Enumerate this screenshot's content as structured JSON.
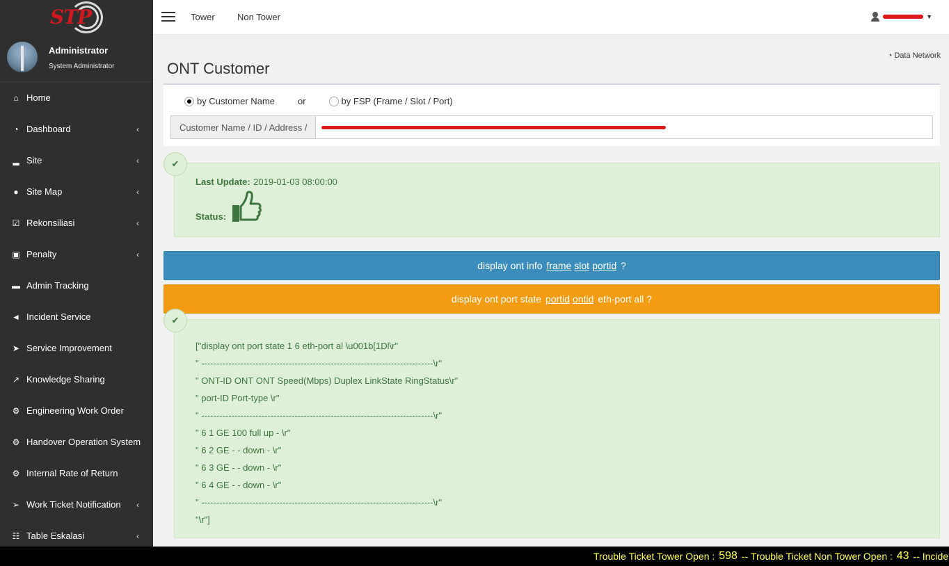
{
  "app": {
    "logo_text": "STP"
  },
  "user_panel": {
    "name": "Administrator",
    "role": "System Administrator"
  },
  "sidebar": {
    "items": [
      {
        "label": "Home",
        "icon": "home-icon",
        "glyph": "⌂",
        "chevron": false
      },
      {
        "label": "Dashboard",
        "icon": "dashboard-icon",
        "glyph": "◔",
        "chevron": true
      },
      {
        "label": "Site",
        "icon": "signal-icon",
        "glyph": "▂",
        "chevron": true
      },
      {
        "label": "Site Map",
        "icon": "globe-icon",
        "glyph": "●",
        "chevron": true
      },
      {
        "label": "Rekonsiliasi",
        "icon": "check-square-icon",
        "glyph": "☑",
        "chevron": true
      },
      {
        "label": "Penalty",
        "icon": "money-icon",
        "glyph": "▣",
        "chevron": true
      },
      {
        "label": "Admin Tracking",
        "icon": "folder-icon",
        "glyph": "▬",
        "chevron": false
      },
      {
        "label": "Incident Service",
        "icon": "bullhorn-icon",
        "glyph": "◄",
        "chevron": false
      },
      {
        "label": "Service Improvement",
        "icon": "rocket-icon",
        "glyph": "➤",
        "chevron": false
      },
      {
        "label": "Knowledge Sharing",
        "icon": "share-icon",
        "glyph": "↗",
        "chevron": false
      },
      {
        "label": "Engineering Work Order",
        "icon": "cogs-icon",
        "glyph": "⚙",
        "chevron": false
      },
      {
        "label": "Handover Operation System",
        "icon": "cogs-icon",
        "glyph": "⚙",
        "chevron": false
      },
      {
        "label": "Internal Rate of Return",
        "icon": "cogs-icon",
        "glyph": "⚙",
        "chevron": false
      },
      {
        "label": "Work Ticket Notification",
        "icon": "location-arrow-icon",
        "glyph": "➢",
        "chevron": true
      },
      {
        "label": "Table Eskalasi",
        "icon": "table-icon",
        "glyph": "☷",
        "chevron": true
      }
    ]
  },
  "topbar": {
    "nav": [
      "Tower",
      "Non Tower"
    ]
  },
  "page": {
    "title": "ONT Customer",
    "breadcrumb": "Data Network"
  },
  "search": {
    "option_customer": "by Customer Name",
    "or_text": "or",
    "option_fsp": "by FSP (Frame / Slot / Port)",
    "addon_label": "Customer Name / ID / Address /"
  },
  "status": {
    "last_update_label": "Last Update:",
    "last_update_value": "2019-01-03 08:00:00",
    "status_label": "Status:"
  },
  "commands": {
    "cmd1": {
      "pre": "display ont info",
      "p1": "frame",
      "p2": "slot",
      "p3": "portid",
      "post": "?"
    },
    "cmd2": {
      "pre": "display ont port state",
      "p1": "portid",
      "p2": "ontid",
      "post": "eth-port all ?"
    }
  },
  "output": {
    "lines": [
      "[\"display ont port state 1 6 eth-port al \\u001b[1Dl\\r\"",
      "\" -----------------------------------------------------------------------------\\r\"",
      "\" ONT-ID ONT ONT Speed(Mbps) Duplex LinkState RingStatus\\r\"",
      "\" port-ID Port-type \\r\"",
      "\" -----------------------------------------------------------------------------\\r\"",
      "\" 6 1 GE 100 full up - \\r\"",
      "\" 6 2 GE - - down - \\r\"",
      "\" 6 3 GE - - down - \\r\"",
      "\" 6 4 GE - - down - \\r\"",
      "\" -----------------------------------------------------------------------------\\r\"",
      "\"\\r\"]"
    ]
  },
  "ticker": {
    "t1": "Trouble Ticket Tower Open :",
    "n1": "598",
    "sep1": "--",
    "t2": "Trouble Ticket Non Tower Open :",
    "n2": "43",
    "sep2": "--",
    "t3": "Incident"
  },
  "colors": {
    "sidebar": "#2f2f2f",
    "blue": "#3c8dbc",
    "orange": "#f39c12",
    "success_bg": "#dff0d8",
    "success_text": "#3c763d",
    "ticker_text": "#ffff4d"
  }
}
